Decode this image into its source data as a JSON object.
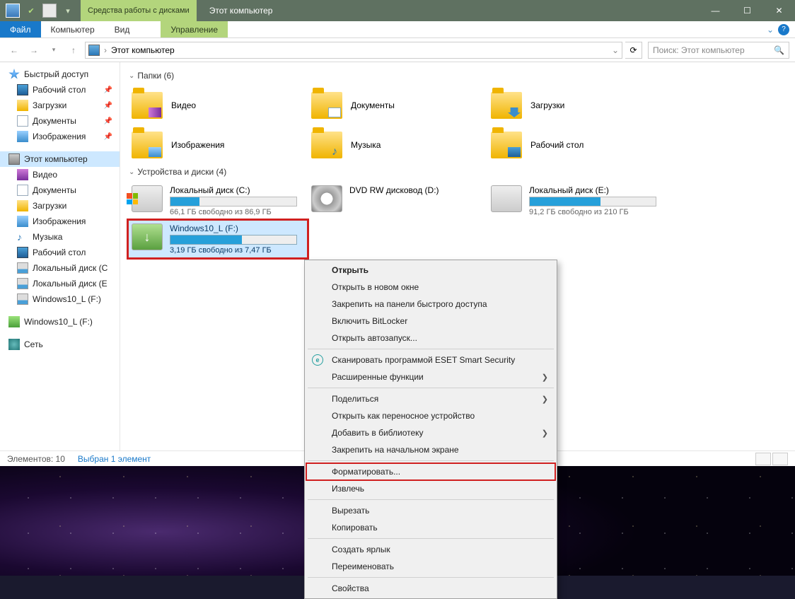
{
  "titlebar": {
    "ribbon_context": "Средства работы с дисками",
    "title": "Этот компьютер"
  },
  "ribbon": {
    "file": "Файл",
    "computer": "Компьютер",
    "view": "Вид",
    "manage": "Управление"
  },
  "address": {
    "path": "Этот компьютер"
  },
  "search": {
    "placeholder": "Поиск: Этот компьютер"
  },
  "nav": {
    "quick": "Быстрый доступ",
    "desktop": "Рабочий стол",
    "downloads": "Загрузки",
    "documents": "Документы",
    "pictures": "Изображения",
    "this_pc": "Этот компьютер",
    "video": "Видео",
    "documents2": "Документы",
    "downloads2": "Загрузки",
    "pictures2": "Изображения",
    "music": "Музыка",
    "desktop2": "Рабочий стол",
    "diskC": "Локальный диск (C",
    "diskE": "Локальный диск (E",
    "usbF": "Windows10_L (F:)",
    "usbF2": "Windows10_L (F:)",
    "network": "Сеть"
  },
  "sections": {
    "folders": "Папки (6)",
    "drives": "Устройства и диски (4)"
  },
  "folders": {
    "video": "Видео",
    "documents": "Документы",
    "downloads": "Загрузки",
    "pictures": "Изображения",
    "music": "Музыка",
    "desktop": "Рабочий стол"
  },
  "drives": {
    "c_label": "Локальный диск (C:)",
    "c_free": "66,1 ГБ свободно из 86,9 ГБ",
    "c_pct": 23,
    "dvd_label": "DVD RW дисковод (D:)",
    "e_label": "Локальный диск (E:)",
    "e_free": "91,2 ГБ свободно из 210 ГБ",
    "e_pct": 56,
    "f_label": "Windows10_L (F:)",
    "f_free": "3,19 ГБ свободно из 7,47 ГБ",
    "f_pct": 57
  },
  "status": {
    "count": "Элементов: 10",
    "sel": "Выбран 1 элемент"
  },
  "menu": {
    "open": "Открыть",
    "open_new": "Открыть в новом окне",
    "pin_quick": "Закрепить на панели быстрого доступа",
    "bitlocker": "Включить BitLocker",
    "autoplay": "Открыть автозапуск...",
    "eset": "Сканировать программой ESET Smart Security",
    "advanced": "Расширенные функции",
    "share": "Поделиться",
    "portable": "Открыть как переносное устройство",
    "library": "Добавить в библиотеку",
    "pin_start": "Закрепить на начальном экране",
    "format": "Форматировать...",
    "eject": "Извлечь",
    "cut": "Вырезать",
    "copy": "Копировать",
    "shortcut": "Создать ярлык",
    "rename": "Переименовать",
    "properties": "Свойства"
  }
}
